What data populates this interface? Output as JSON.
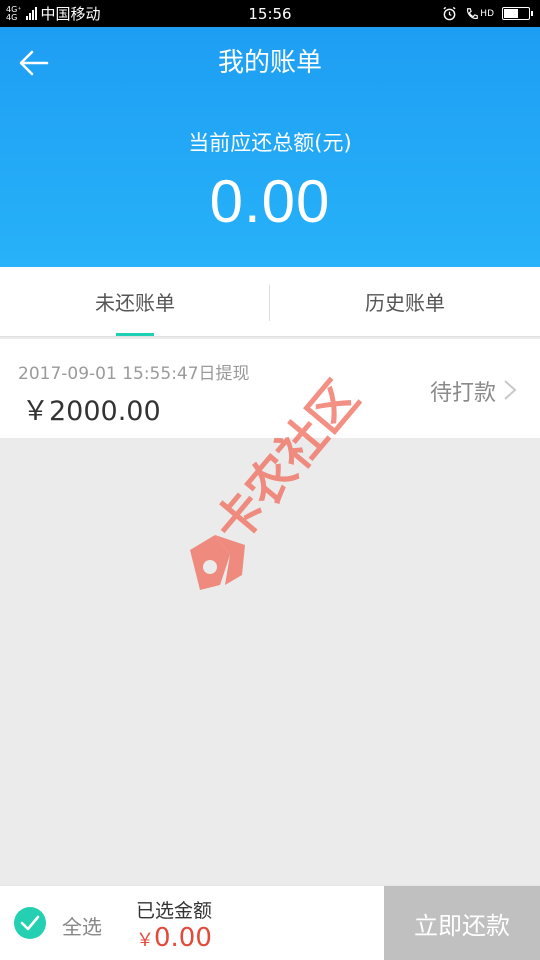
{
  "status_bar": {
    "network_top": "4G⁺",
    "network_bottom": "4G",
    "carrier": "中国移动",
    "time": "15:56",
    "hd": "HD"
  },
  "header": {
    "title": "我的账单",
    "total_label": "当前应还总额(元)",
    "total_amount": "0.00"
  },
  "tabs": [
    {
      "label": "未还账单",
      "active": true
    },
    {
      "label": "历史账单",
      "active": false
    }
  ],
  "bills": [
    {
      "datetime_action": "2017-09-01 15:55:47日提现",
      "amount": "￥2000.00",
      "status": "待打款"
    }
  ],
  "watermark": {
    "text": "卡农社区"
  },
  "footer": {
    "select_all": "全选",
    "selected_label": "已选金额",
    "currency": "￥",
    "selected_amount": "0.00",
    "pay_button": "立即还款"
  },
  "colors": {
    "header_blue": "#1e9ef3",
    "tab_indicator": "#1fd1b4",
    "check_green": "#24cfb2",
    "amount_red": "#e24b3b",
    "button_gray": "#c0c0c0",
    "watermark_red": "#f06a5a"
  }
}
